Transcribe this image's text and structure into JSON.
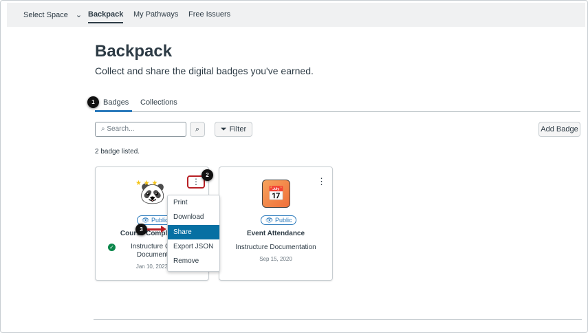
{
  "nav": {
    "select_space": "Select Space",
    "items": [
      "Backpack",
      "My Pathways",
      "Free Issuers"
    ]
  },
  "page": {
    "title": "Backpack",
    "subtitle": "Collect and share the digital badges you've earned."
  },
  "tabs": [
    "Badges",
    "Collections"
  ],
  "toolbar": {
    "search_placeholder": "Search...",
    "filter": "Filter",
    "add_badge": "Add Badge"
  },
  "count": "2 badge listed.",
  "badges": [
    {
      "title": "Course Completion",
      "issuer": "Instructure Content Documentation",
      "date": "Jan 10, 2023",
      "visibility": "Public",
      "verified": true
    },
    {
      "title": "Event Attendance",
      "issuer": "Instructure Documentation",
      "date": "Sep 15, 2020",
      "visibility": "Public"
    }
  ],
  "menu": [
    "Print",
    "Download",
    "Share",
    "Export JSON",
    "Remove"
  ],
  "steps": [
    "1",
    "2",
    "3"
  ],
  "colors": {
    "accent": "#0770a3",
    "highlight": "#b81f24"
  }
}
